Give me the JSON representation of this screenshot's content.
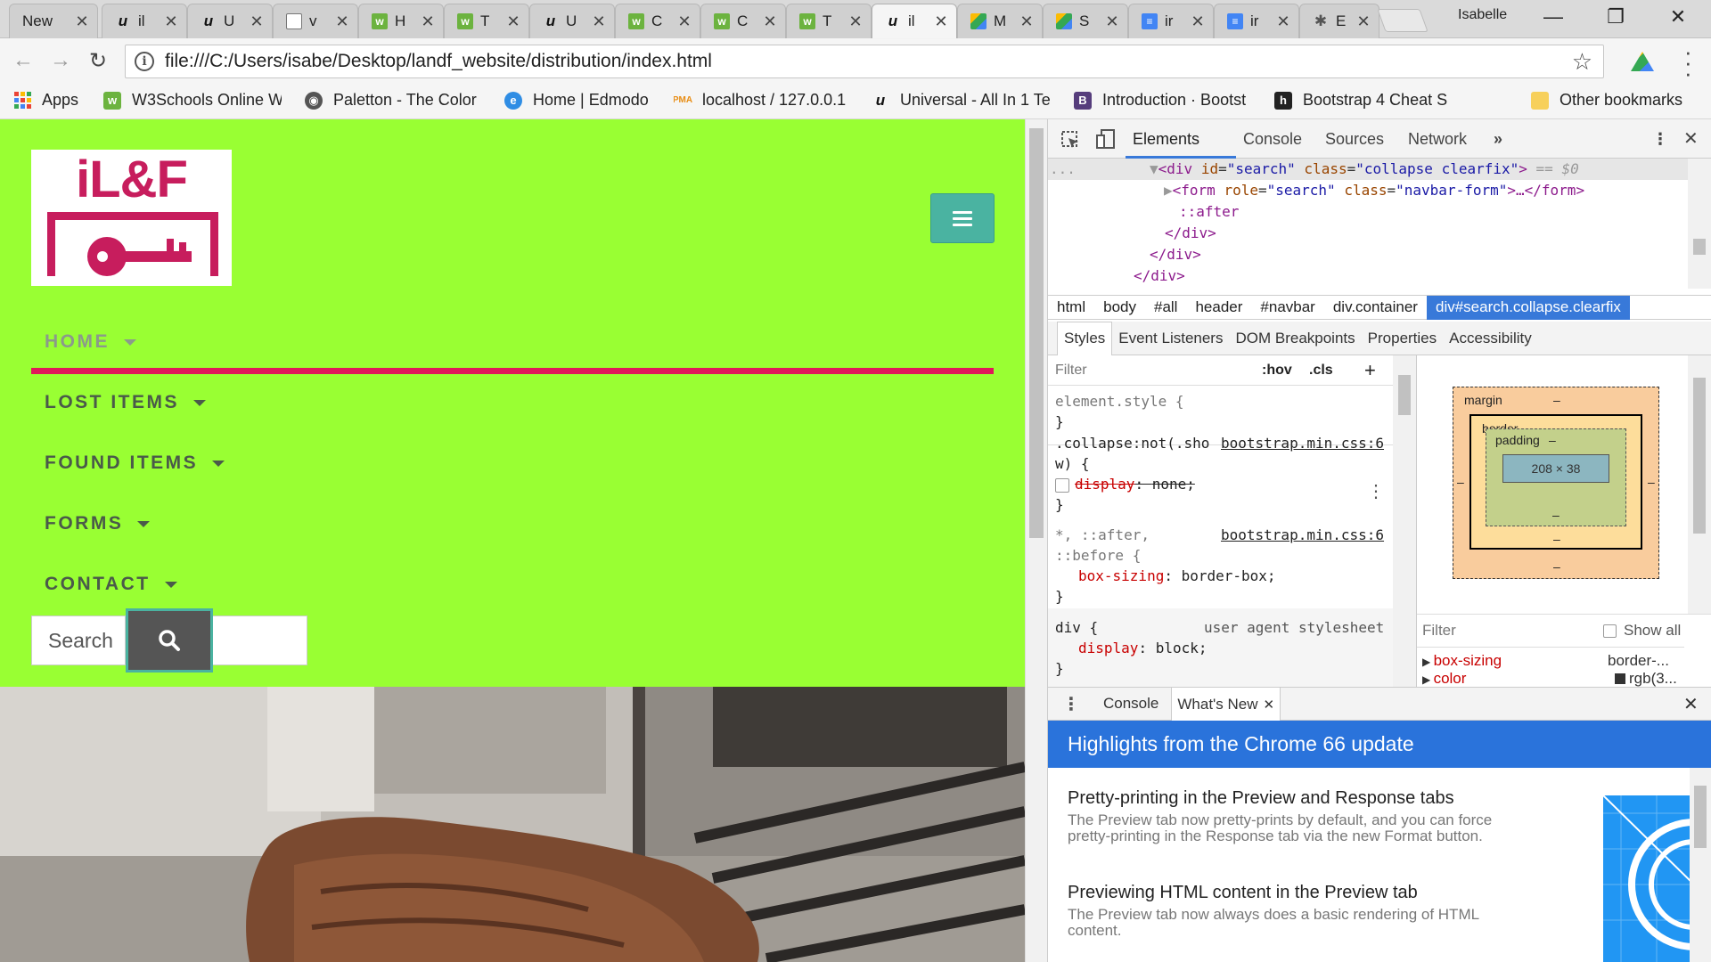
{
  "browser": {
    "tabs": [
      {
        "label": "New",
        "icon": "none"
      },
      {
        "label": "il",
        "icon": "u-icon"
      },
      {
        "label": "U",
        "icon": "u-icon"
      },
      {
        "label": "v",
        "icon": "document-icon"
      },
      {
        "label": "H",
        "icon": "w3schools-icon"
      },
      {
        "label": "T",
        "icon": "w3schools-icon"
      },
      {
        "label": "U",
        "icon": "u-icon"
      },
      {
        "label": "C",
        "icon": "w3schools-icon"
      },
      {
        "label": "C",
        "icon": "w3schools-icon"
      },
      {
        "label": "T",
        "icon": "w3schools-icon"
      },
      {
        "label": "il",
        "icon": "u-icon"
      },
      {
        "label": "M",
        "icon": "google-drive-icon"
      },
      {
        "label": "S",
        "icon": "google-drive-icon"
      },
      {
        "label": "ir",
        "icon": "google-docs-icon"
      },
      {
        "label": "ir",
        "icon": "google-docs-icon"
      },
      {
        "label": "E",
        "icon": "puzzle-icon"
      }
    ],
    "profile": "Isabelle",
    "url": "file:///C:/Users/isabe/Desktop/landf_website/distribution/index.html",
    "bookmarks": [
      {
        "label": "Apps"
      },
      {
        "label": "W3Schools Online W"
      },
      {
        "label": "Paletton - The Color"
      },
      {
        "label": "Home | Edmodo"
      },
      {
        "label": "localhost / 127.0.0.1"
      },
      {
        "label": "Universal - All In 1 Te"
      },
      {
        "label": "Introduction · Bootst"
      },
      {
        "label": "Bootstrap 4 Cheat S"
      },
      {
        "label": "Other bookmarks"
      }
    ]
  },
  "site": {
    "logo_text": "iL&F",
    "menu": [
      {
        "label": "HOME"
      },
      {
        "label": "LOST ITEMS"
      },
      {
        "label": "FOUND ITEMS"
      },
      {
        "label": "FORMS"
      },
      {
        "label": "CONTACT"
      }
    ],
    "search_placeholder": "Search",
    "colors": {
      "navbar": "#99ff33",
      "accent": "#e0185a",
      "toggler": "#4ab3a1"
    }
  },
  "devtools": {
    "tabs": [
      "Elements",
      "Console",
      "Sources",
      "Network"
    ],
    "dom": {
      "ellipsis": "...",
      "line1_tag_open": "<div",
      "line1_attr1": "id",
      "line1_val1": "\"search\"",
      "line1_attr2": "class",
      "line1_val2": "\"collapse clearfix\"",
      "line1_end": ">",
      "line1_eq": "== $0",
      "line2_tag_open": "<form",
      "line2_attr1": "role",
      "line2_val1": "\"search\"",
      "line2_attr2": "class",
      "line2_val2": "\"navbar-form\"",
      "line2_end": ">…</form>",
      "line3": "::after",
      "line4": "</div>",
      "line5": "</div>",
      "line6": "</div>"
    },
    "breadcrumbs": [
      "html",
      "body",
      "#all",
      "header",
      "#navbar",
      "div.container",
      "div#search.collapse.clearfix"
    ],
    "subtabs": [
      "Styles",
      "Event Listeners",
      "DOM Breakpoints",
      "Properties",
      "Accessibility"
    ],
    "styles": {
      "filter_placeholder": "Filter",
      "hov": ":hov",
      "cls": ".cls",
      "plus": "+",
      "element_style": "element.style {",
      "close_brace": "}",
      "rule1_selector": ".collapse:not(.sho",
      "rule1_selector_cont": "w) {",
      "rule1_source": "bootstrap.min.css:6",
      "rule1_prop": "display",
      "rule1_value": "none;",
      "rule2_selector": "*, ::after,",
      "rule2_selector_cont": "::before {",
      "rule2_source": "bootstrap.min.css:6",
      "rule2_prop": "box-sizing",
      "rule2_value": "border-box;",
      "rule3_selector": "div {",
      "rule3_source": "user agent stylesheet",
      "rule3_prop": "display",
      "rule3_value": "block;"
    },
    "boxmodel": {
      "margin_label": "margin",
      "border_label": "border",
      "padding_label": "padding",
      "dash": "–",
      "content_size": "208 × 38"
    },
    "computed": {
      "filter_placeholder": "Filter",
      "show_all": "Show all",
      "rows": [
        {
          "prop": "box-sizing",
          "value": "border-..."
        },
        {
          "prop": "color",
          "value": "rgb(3..."
        }
      ]
    },
    "drawer_tabs": [
      "Console",
      "What's New"
    ],
    "whats_new": {
      "header": "Highlights from the Chrome 66 update",
      "items": [
        {
          "title": "Pretty-printing in the Preview and Response tabs",
          "body": "The Preview tab now pretty-prints by default, and you can force pretty-printing in the Response tab via the new Format button."
        },
        {
          "title": "Previewing HTML content in the Preview tab",
          "body": "The Preview tab now always does a basic rendering of HTML content."
        }
      ]
    }
  }
}
